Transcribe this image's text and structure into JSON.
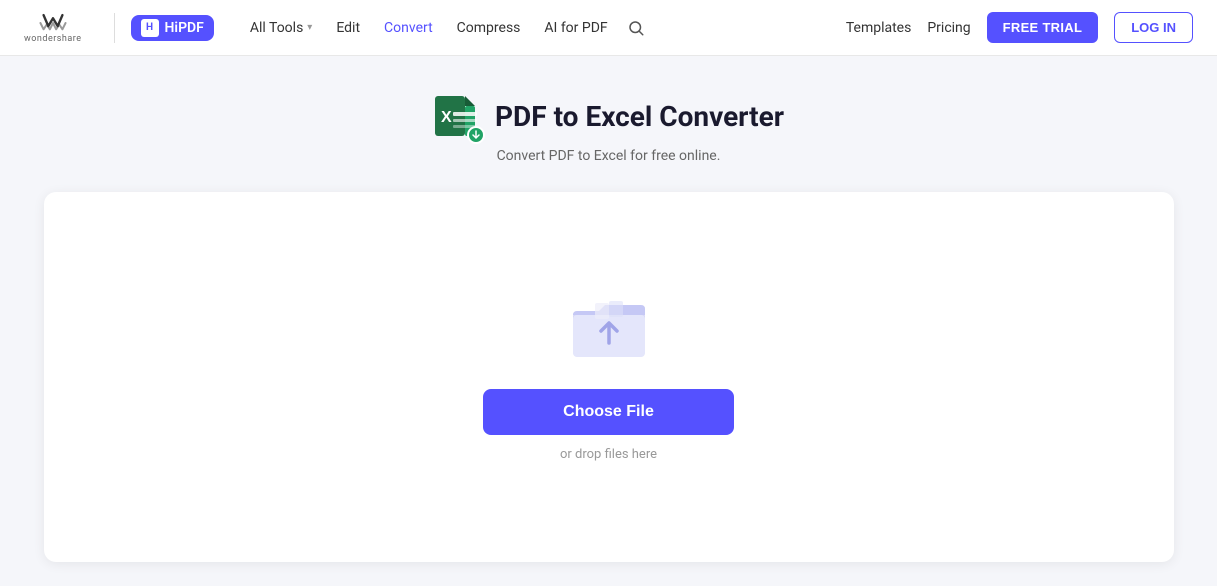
{
  "brand": {
    "wondershare_label": "wondershare",
    "hipdf_label": "HiPDF"
  },
  "navbar": {
    "all_tools_label": "All Tools",
    "edit_label": "Edit",
    "convert_label": "Convert",
    "compress_label": "Compress",
    "ai_for_pdf_label": "AI for PDF",
    "templates_label": "Templates",
    "pricing_label": "Pricing",
    "free_trial_label": "FREE TRIAL",
    "login_label": "LOG IN"
  },
  "page": {
    "title": "PDF to Excel Converter",
    "subtitle": "Convert PDF to Excel for free online."
  },
  "upload": {
    "choose_file_label": "Choose File",
    "drop_hint": "or drop files here"
  }
}
